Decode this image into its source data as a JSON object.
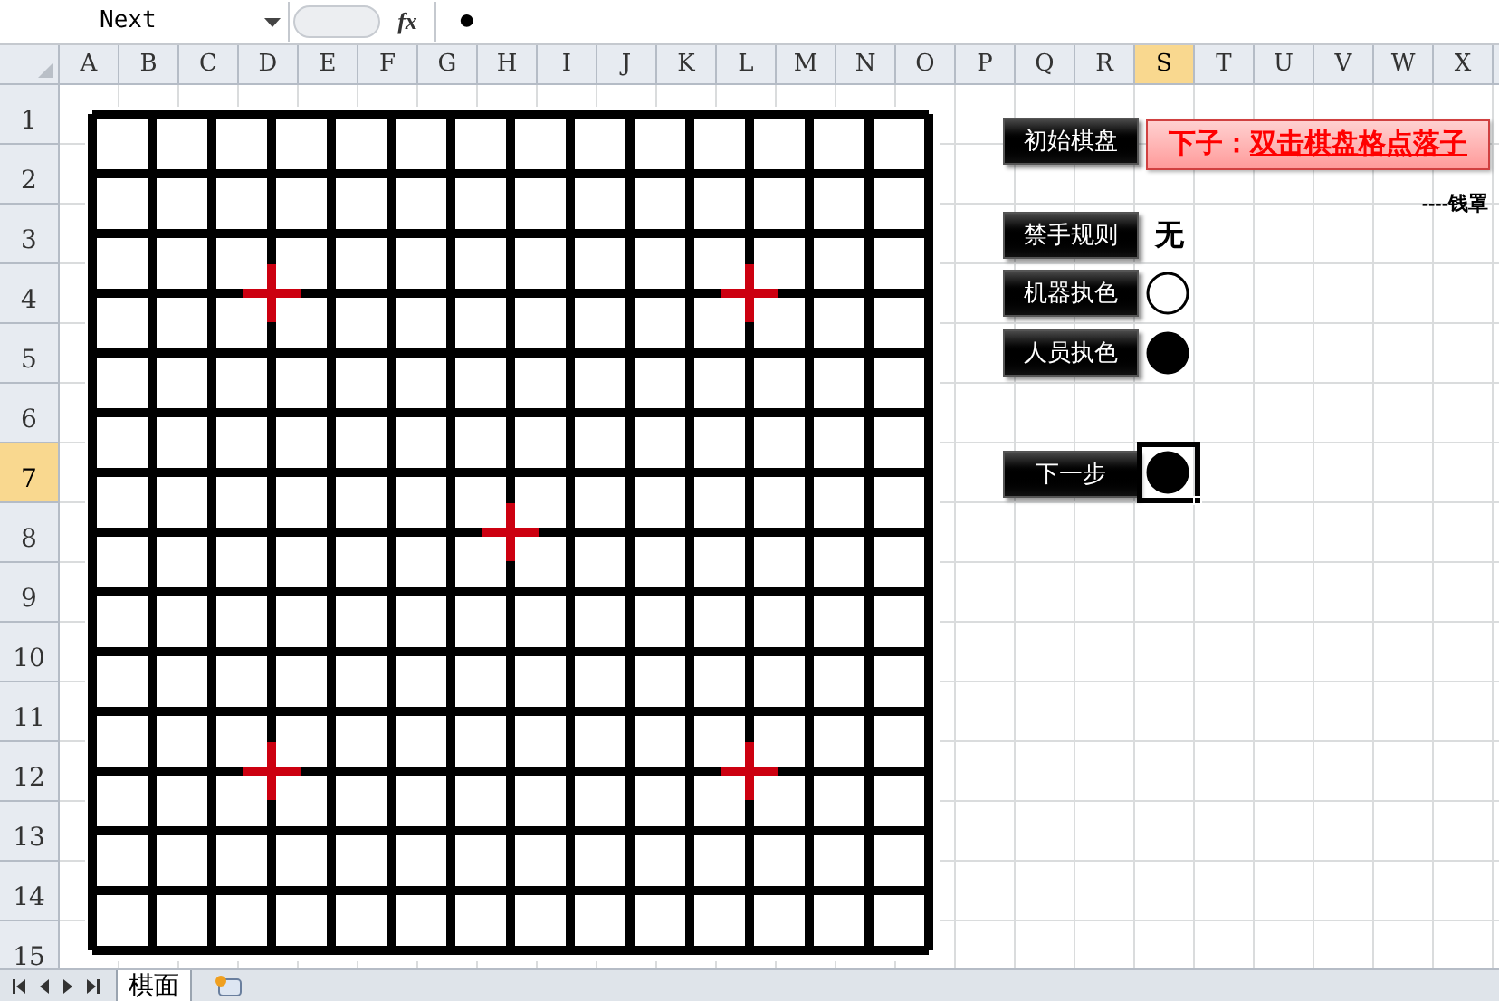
{
  "name_box": "Next",
  "function_label": "fx",
  "formula": "●",
  "columns": [
    {
      "label": "A",
      "selected": false
    },
    {
      "label": "B",
      "selected": false
    },
    {
      "label": "C",
      "selected": false
    },
    {
      "label": "D",
      "selected": false
    },
    {
      "label": "E",
      "selected": false
    },
    {
      "label": "F",
      "selected": false
    },
    {
      "label": "G",
      "selected": false
    },
    {
      "label": "H",
      "selected": false
    },
    {
      "label": "I",
      "selected": false
    },
    {
      "label": "J",
      "selected": false
    },
    {
      "label": "K",
      "selected": false
    },
    {
      "label": "L",
      "selected": false
    },
    {
      "label": "M",
      "selected": false
    },
    {
      "label": "N",
      "selected": false
    },
    {
      "label": "O",
      "selected": false
    },
    {
      "label": "P",
      "selected": false
    },
    {
      "label": "Q",
      "selected": false
    },
    {
      "label": "R",
      "selected": false
    },
    {
      "label": "S",
      "selected": true
    },
    {
      "label": "T",
      "selected": false
    },
    {
      "label": "U",
      "selected": false
    },
    {
      "label": "V",
      "selected": false
    },
    {
      "label": "W",
      "selected": false
    },
    {
      "label": "X",
      "selected": false
    }
  ],
  "rows": [
    {
      "label": "1",
      "selected": false
    },
    {
      "label": "2",
      "selected": false
    },
    {
      "label": "3",
      "selected": false
    },
    {
      "label": "4",
      "selected": false
    },
    {
      "label": "5",
      "selected": false
    },
    {
      "label": "6",
      "selected": false
    },
    {
      "label": "7",
      "selected": true
    },
    {
      "label": "8",
      "selected": false
    },
    {
      "label": "9",
      "selected": false
    },
    {
      "label": "10",
      "selected": false
    },
    {
      "label": "11",
      "selected": false
    },
    {
      "label": "12",
      "selected": false
    },
    {
      "label": "13",
      "selected": false
    },
    {
      "label": "14",
      "selected": false
    },
    {
      "label": "15",
      "selected": false
    }
  ],
  "init_button": "初始棋盘",
  "hint": {
    "prefix": "下子：",
    "link": "双击棋盘格点落子"
  },
  "author": "----钱罩",
  "settings": [
    {
      "label": "禁手规则",
      "kind": "text",
      "value": "无"
    },
    {
      "label": "机器执色",
      "kind": "stone",
      "color": "#ffffff"
    },
    {
      "label": "人员执色",
      "kind": "stone",
      "color": "#000000"
    }
  ],
  "next_step": {
    "label": "下一步",
    "color": "#000000",
    "selected": true
  },
  "sheet_tabs": [
    {
      "label": "棋面",
      "selected": true
    }
  ]
}
